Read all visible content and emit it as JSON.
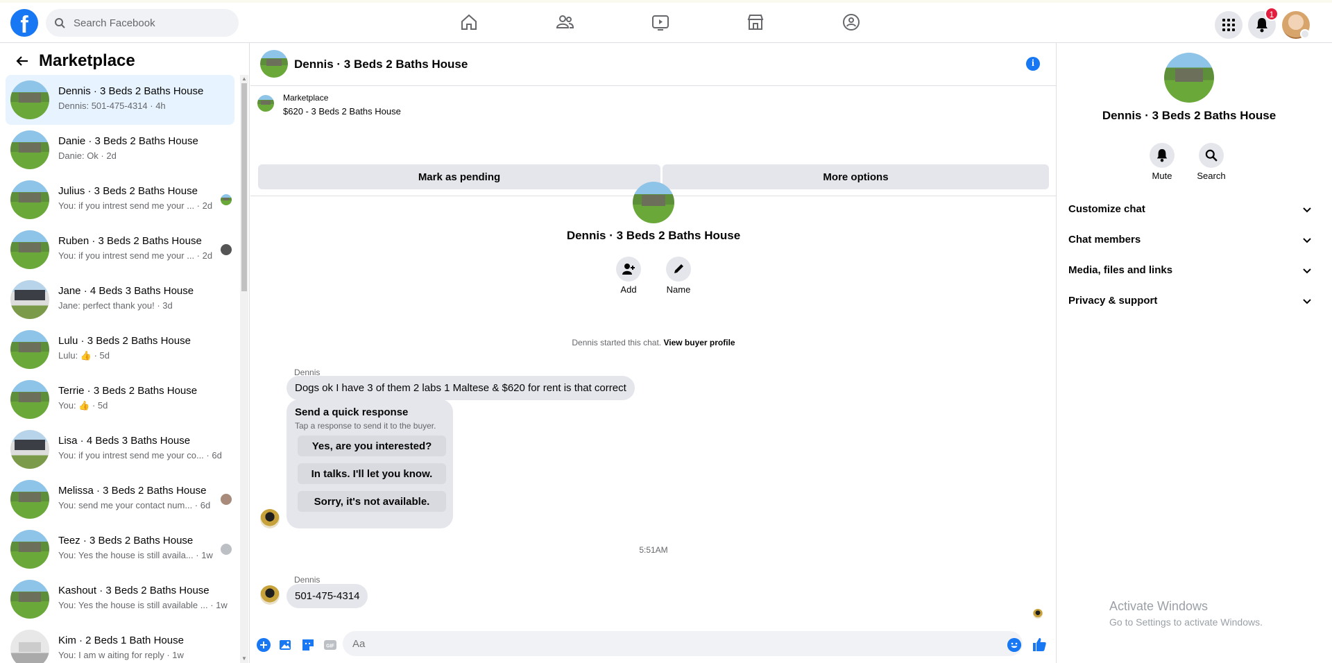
{
  "topbar": {
    "logo_letter": "f",
    "search_placeholder": "Search Facebook",
    "nav_icons": [
      "home-icon",
      "friends-icon",
      "watch-icon",
      "marketplace-icon",
      "groups-icon"
    ],
    "right_icons": [
      "menu-grid-icon",
      "bell-icon",
      "profile-avatar"
    ],
    "notification_count": "1"
  },
  "sidebar": {
    "title": "Marketplace",
    "conversations": [
      {
        "name": "Dennis · 3 Beds 2 Baths House",
        "preview": "Dennis: 501-475-4314 · 4h",
        "active": true,
        "thumb": "green"
      },
      {
        "name": "Danie · 3 Beds 2 Baths House",
        "preview": "Danie: Ok · 2d",
        "thumb": "green"
      },
      {
        "name": "Julius · 3 Beds 2 Baths House",
        "preview": "You: if you intrest send me your ... · 2d",
        "thumb": "green"
      },
      {
        "name": "Ruben · 3 Beds 2 Baths House",
        "preview": "You: if you intrest send me your ... · 2d",
        "thumb": "green"
      },
      {
        "name": "Jane · 4 Beds 3 Baths House",
        "preview": "Jane: perfect thank you! · 3d",
        "thumb": "white"
      },
      {
        "name": "Lulu · 3 Beds 2 Baths House",
        "preview": "Lulu: 👍 · 5d",
        "thumb": "green"
      },
      {
        "name": "Terrie · 3 Beds 2 Baths House",
        "preview": "You: 👍 · 5d",
        "thumb": "green"
      },
      {
        "name": "Lisa · 4 Beds 3 Baths House",
        "preview": "You: if you intrest send me your co... · 6d",
        "thumb": "white"
      },
      {
        "name": "Melissa · 3 Beds 2 Baths House",
        "preview": "You: send me your contact num... · 6d",
        "thumb": "green"
      },
      {
        "name": "Teez · 3 Beds 2 Baths House",
        "preview": "You: Yes the house is still availa... · 1w",
        "thumb": "green"
      },
      {
        "name": "Kashout · 3 Beds 2 Baths House",
        "preview": "You: Yes the house is still available ... · 1w",
        "thumb": "green"
      },
      {
        "name": "Kim · 2 Beds 1 Bath House",
        "preview": "You: I am w aiting for reply · 1w",
        "thumb": "interior"
      }
    ]
  },
  "chat": {
    "header_title": "Dennis · 3 Beds 2 Baths House",
    "marketplace_label": "Marketplace",
    "listing_price": "$620 - 3 Beds 2 Baths House",
    "mark_pending": "Mark as pending",
    "more_options": "More options",
    "intro_name": "Dennis · 3 Beds 2 Baths House",
    "add_label": "Add",
    "name_label": "Name",
    "started_text": "Dennis started this chat.",
    "view_profile": "View buyer profile",
    "sender_1": "Dennis",
    "message_1": "Dogs ok I have 3 of them 2 labs 1 Maltese & $620 for rent is that correct",
    "quick_title": "Send a quick response",
    "quick_subtitle": "Tap a response to send it to the buyer.",
    "quick_1": "Yes, are you interested?",
    "quick_2": "In talks. I'll let you know.",
    "quick_3": "Sorry, it's not available.",
    "timestamp": "5:51AM",
    "sender_2": "Dennis",
    "message_2": "501-475-4314",
    "composer_placeholder": "Aa",
    "composer_gif": "GIF"
  },
  "info_panel": {
    "name": "Dennis · 3 Beds 2 Baths House",
    "mute_label": "Mute",
    "search_label": "Search",
    "sections": [
      "Customize chat",
      "Chat members",
      "Media, files and links",
      "Privacy & support"
    ]
  },
  "watermark": {
    "line1": "Activate Windows",
    "line2": "Go to Settings to activate Windows."
  },
  "colors": {
    "accent": "#1877f2",
    "active_row": "#e7f3ff",
    "badge": "#e41e3f"
  }
}
